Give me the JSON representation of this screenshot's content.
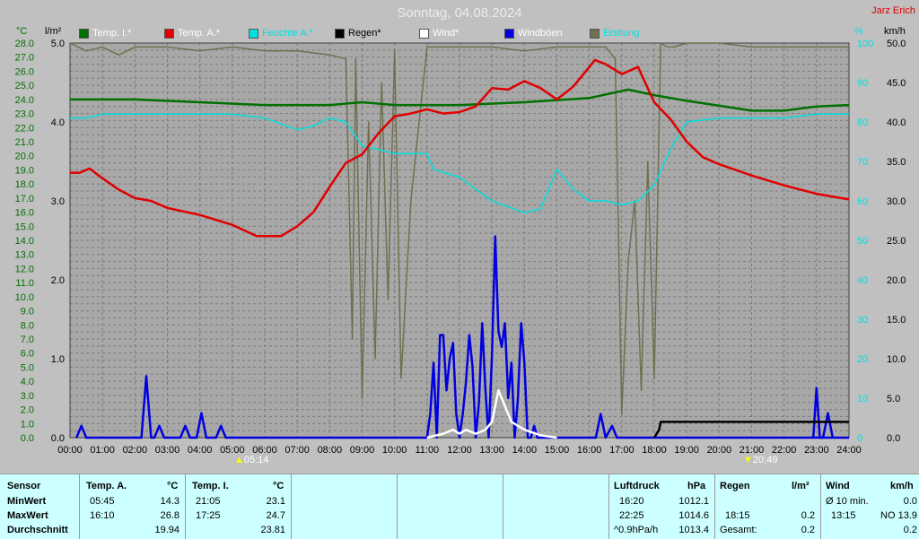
{
  "header": {
    "title": "Sonntag, 04.08.2024",
    "author": "Jarz Erich"
  },
  "legend": [
    {
      "label": "Temp. I.*",
      "color": "#007000",
      "text_color": "#ffffff"
    },
    {
      "label": "Temp. A.*",
      "color": "#e00000",
      "text_color": "#ffffff"
    },
    {
      "label": "Feuchte A.*",
      "color": "#00e0e0",
      "text_color": "#00e0e0"
    },
    {
      "label": "Regen*",
      "color": "#000000",
      "text_color": "#000000"
    },
    {
      "label": "Wind*",
      "color": "#ffffff",
      "text_color": "#ffffff"
    },
    {
      "label": "Windböen",
      "color": "#0000e0",
      "text_color": "#ffffff"
    },
    {
      "label": "Erstlung",
      "color": "#707050",
      "text_color": "#00e0e0"
    }
  ],
  "axis_units": {
    "temp": "°C",
    "rain": "l/m²",
    "humidity": "%",
    "wind": "km/h"
  },
  "sun": {
    "rise": "05:14",
    "set": "20:49"
  },
  "chart_data": {
    "type": "line",
    "title": "Sonntag, 04.08.2024",
    "x_ticks": [
      "00:00",
      "01:00",
      "02:00",
      "03:00",
      "04:00",
      "05:00",
      "06:00",
      "07:00",
      "08:00",
      "09:00",
      "10:00",
      "11:00",
      "12:00",
      "13:00",
      "14:00",
      "15:00",
      "16:00",
      "17:00",
      "18:00",
      "19:00",
      "20:00",
      "21:00",
      "22:00",
      "23:00",
      "24:00"
    ],
    "axes": {
      "temp": {
        "min": 0.0,
        "max": 28.0,
        "step": 0.5
      },
      "rain": {
        "min": 0.0,
        "max": 5.0,
        "ticks": [
          "0.0",
          "1.0",
          "2.0",
          "3.0",
          "4.0",
          "5.0"
        ]
      },
      "humidity": {
        "min": 0,
        "max": 100,
        "ticks": [
          "0",
          "10",
          "20",
          "30",
          "40",
          "50",
          "60",
          "70",
          "80",
          "90",
          "100"
        ]
      },
      "wind": {
        "min": 0.0,
        "max": 50.0,
        "ticks": [
          "0.0",
          "5.0",
          "10.0",
          "15.0",
          "20.0",
          "25.0",
          "30.0",
          "35.0",
          "40.0",
          "45.0",
          "50.0"
        ]
      }
    },
    "series": [
      {
        "name": "Temp. I.*",
        "axis": "temp",
        "color": "#007000",
        "x": [
          0,
          2,
          4,
          6,
          8,
          9,
          10,
          12,
          14,
          16,
          17.2,
          18,
          19,
          21,
          22,
          23,
          24
        ],
        "y": [
          24.0,
          24.0,
          23.8,
          23.6,
          23.6,
          23.8,
          23.6,
          23.6,
          23.8,
          24.1,
          24.7,
          24.3,
          23.9,
          23.2,
          23.2,
          23.5,
          23.6
        ]
      },
      {
        "name": "Temp. A.*",
        "axis": "temp",
        "color": "#e00000",
        "x": [
          0,
          0.3,
          0.6,
          1,
          1.5,
          2,
          2.5,
          3,
          4,
          5,
          5.75,
          6,
          6.5,
          7,
          7.5,
          8,
          8.5,
          9,
          9.5,
          10,
          10.5,
          11,
          11.5,
          12,
          12.5,
          13,
          13.5,
          14,
          14.5,
          15,
          15.5,
          16,
          16.17,
          16.5,
          17,
          17.5,
          18,
          18.5,
          19,
          19.5,
          20,
          21,
          22,
          23,
          24
        ],
        "y": [
          18.8,
          18.8,
          19.1,
          18.4,
          17.6,
          17.0,
          16.8,
          16.3,
          15.8,
          15.1,
          14.3,
          14.3,
          14.3,
          15.0,
          16.0,
          17.8,
          19.5,
          20.1,
          21.6,
          22.8,
          23.0,
          23.3,
          23.0,
          23.1,
          23.5,
          24.8,
          24.7,
          25.3,
          24.8,
          24.0,
          24.9,
          26.3,
          26.8,
          26.5,
          25.8,
          26.3,
          23.8,
          22.6,
          21.0,
          19.9,
          19.4,
          18.6,
          17.9,
          17.3,
          16.9
        ]
      },
      {
        "name": "Feuchte A.*",
        "axis": "humidity",
        "color": "#00e0e0",
        "x": [
          0,
          0.5,
          1,
          2,
          3,
          4,
          5,
          6,
          7,
          7.5,
          8,
          8.5,
          9,
          10,
          11,
          11.2,
          12,
          13,
          14,
          14.5,
          15,
          15.5,
          16,
          16.5,
          17,
          17.5,
          18,
          18.5,
          19,
          20,
          21,
          22,
          23,
          24
        ],
        "y": [
          81,
          81,
          82,
          82,
          82,
          82,
          82,
          81,
          78,
          79,
          81,
          80,
          74,
          72,
          72,
          68,
          66,
          60,
          57,
          58,
          68,
          63,
          60,
          60,
          59,
          60,
          64,
          73,
          80,
          81,
          81,
          81,
          82,
          82
        ]
      },
      {
        "name": "Erstlung",
        "axis": "humidity",
        "color": "#707050",
        "x": [
          0,
          0.5,
          1,
          1.5,
          2,
          3,
          4,
          5,
          6,
          7,
          8,
          8.5,
          8.7,
          8.8,
          9,
          9.2,
          9.4,
          9.6,
          9.8,
          10,
          10.2,
          10.5,
          11,
          12,
          13,
          14,
          15,
          16,
          16.5,
          16.8,
          17,
          17.2,
          17.4,
          17.6,
          17.8,
          18,
          18.2,
          18.4,
          18.6,
          19,
          20,
          21,
          22,
          23,
          24
        ],
        "y": [
          100,
          98,
          99,
          97,
          99,
          99,
          98,
          99,
          98,
          98,
          97,
          96,
          25,
          96,
          10,
          80,
          20,
          90,
          35,
          98,
          15,
          60,
          99,
          99,
          99,
          98,
          99,
          99,
          99,
          96,
          6,
          45,
          60,
          12,
          70,
          15,
          100,
          99,
          99,
          100,
          100,
          99,
          99,
          99,
          99
        ]
      },
      {
        "name": "Regen*",
        "axis": "rain",
        "color": "#000000",
        "x": [
          18.0,
          18.15,
          18.2,
          18.5,
          19,
          20,
          21,
          22,
          23,
          24
        ],
        "y": [
          0.0,
          0.1,
          0.2,
          0.2,
          0.2,
          0.2,
          0.2,
          0.2,
          0.2,
          0.2
        ]
      },
      {
        "name": "Wind*",
        "axis": "wind",
        "color": "#ffffff",
        "x": [
          11.0,
          11.5,
          11.8,
          12,
          12.2,
          12.5,
          12.8,
          13,
          13.2,
          13.4,
          13.6,
          14,
          14.5,
          15
        ],
        "y": [
          0,
          0.5,
          1.0,
          0.5,
          1.0,
          0.5,
          1.0,
          2.0,
          6.0,
          4.0,
          2.0,
          1.0,
          0.3,
          0
        ]
      },
      {
        "name": "Windböen",
        "axis": "wind",
        "color": "#0000e0",
        "x": [
          0.2,
          0.35,
          0.5,
          2.2,
          2.35,
          2.5,
          2.6,
          2.75,
          2.9,
          3.4,
          3.55,
          3.7,
          3.9,
          4.05,
          4.2,
          4.5,
          4.65,
          4.8,
          11.0,
          11.1,
          11.2,
          11.3,
          11.4,
          11.5,
          11.6,
          11.7,
          11.8,
          11.9,
          12.0,
          12.1,
          12.2,
          12.3,
          12.4,
          12.5,
          12.6,
          12.7,
          12.8,
          12.9,
          13.0,
          13.1,
          13.2,
          13.3,
          13.4,
          13.5,
          13.6,
          13.7,
          13.8,
          13.9,
          14.0,
          14.1,
          14.2,
          14.3,
          14.4,
          14.5,
          14.6,
          14.7,
          14.8,
          16.2,
          16.35,
          16.5,
          16.7,
          16.85,
          17.0,
          24.0
        ],
        "y": [
          0,
          1.5,
          0,
          0,
          7.8,
          0,
          0,
          1.5,
          0,
          0,
          1.5,
          0,
          0,
          3.1,
          0,
          0,
          1.5,
          0,
          0,
          3.0,
          9.5,
          0,
          13.0,
          13.0,
          6.0,
          10.0,
          12.0,
          3.0,
          0,
          3.0,
          7.0,
          13.0,
          9.0,
          0,
          4.5,
          14.5,
          6.0,
          0,
          10.5,
          25.5,
          13.5,
          11.5,
          14.5,
          5.0,
          9.5,
          0,
          5.0,
          14.5,
          9.5,
          0,
          0,
          1.5,
          0,
          0,
          0,
          0,
          0,
          0,
          3.0,
          0,
          1.5,
          0,
          0,
          0
        ]
      },
      {
        "name": "Windböen_late",
        "axis": "wind",
        "color": "#0000e0",
        "x": [
          22.9,
          23.0,
          23.1,
          23.2,
          23.35,
          23.5
        ],
        "y": [
          0,
          6.3,
          0,
          0,
          3.1,
          0
        ]
      }
    ]
  },
  "table": {
    "sensor": {
      "header": "Sensor",
      "rows": [
        "MinWert",
        "MaxWert",
        "Durchschnitt"
      ]
    },
    "temp_a": {
      "header": "Temp. A.",
      "unit": "°C",
      "times": [
        "05:45",
        "16:10",
        ""
      ],
      "values": [
        "14.3",
        "26.8",
        "19.94"
      ]
    },
    "temp_i": {
      "header": "Temp. I.",
      "unit": "°C",
      "times": [
        "21:05",
        "17:25",
        ""
      ],
      "values": [
        "23.1",
        "24.7",
        "23.81"
      ]
    },
    "luftdruck": {
      "header": "Luftdruck",
      "unit": "hPa",
      "times": [
        "16:20",
        "22:25",
        "^0.9hPa/h"
      ],
      "values": [
        "1012.1",
        "1014.6",
        "1013.4"
      ]
    },
    "regen": {
      "header": "Regen",
      "unit": "l/m²",
      "times": [
        "",
        "18:15",
        "Gesamt:"
      ],
      "values": [
        "",
        "0.2",
        "0.2"
      ]
    },
    "wind": {
      "header": "Wind",
      "unit": "km/h",
      "times": [
        "Ø 10 min.",
        "13:15",
        ""
      ],
      "values": [
        "0.0",
        "NO 13.9",
        "0.2"
      ]
    }
  }
}
